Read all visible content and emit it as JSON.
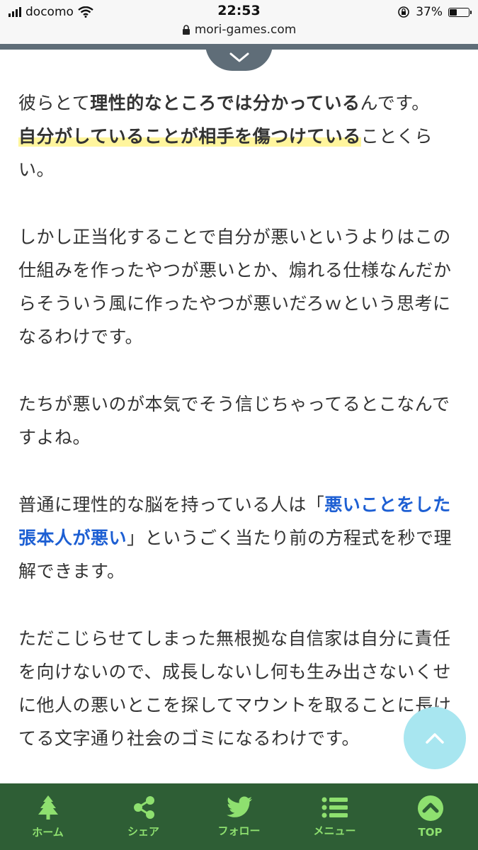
{
  "status_bar": {
    "carrier": "docomo",
    "time": "22:53",
    "battery": "37%",
    "battery_level": 0.37,
    "url": "mori-games.com"
  },
  "colors": {
    "nav_bg": "#2e5e35",
    "nav_label": "#8ee06f",
    "link": "#1d5fd3",
    "marker": "#fff59d",
    "scroll_top_button": "#a8e6f0"
  },
  "article": {
    "p1": {
      "t1": "彼らとて",
      "b1": "理性的なところでは分かっている",
      "t2": "んです。",
      "m1": "自分がしていることが相手を傷つけている",
      "t3": "ことくらい。"
    },
    "p2": "しかし正当化することで自分が悪いというよりはこの仕組みを作ったやつが悪いとか、煽れる仕様なんだからそういう風に作ったやつが悪いだろｗという思考になるわけです。",
    "p3": "たちが悪いのが本気でそう信じちゃってるとこなんですよね。",
    "p4": {
      "t1": "普通に理性的な脳を持っている人は「",
      "link": "悪いことをした張本人が悪い",
      "t2": "」というごく当たり前の方程式を秒で理解できます。"
    },
    "p5": "ただこじらせてしまった無根拠な自信家は自分に責任を向けないので、成長しないし何も生み出さないくせに他人の悪いとこを探してマウントを取ることに長けてる文字通り社会のゴミになるわけです。"
  },
  "bottom_nav": [
    {
      "label": "ホーム",
      "icon": "tree-icon"
    },
    {
      "label": "シェア",
      "icon": "share-icon"
    },
    {
      "label": "フォロー",
      "icon": "twitter-icon"
    },
    {
      "label": "メニュー",
      "icon": "menu-icon"
    },
    {
      "label": "TOP",
      "icon": "chevron-up-circle-icon"
    }
  ]
}
